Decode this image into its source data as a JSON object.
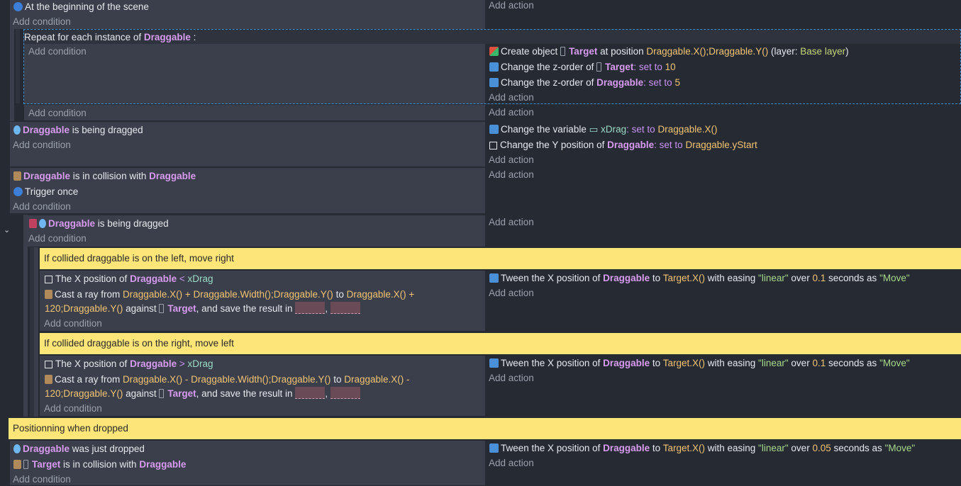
{
  "labels": {
    "add_condition": "Add condition",
    "add_action": "Add action"
  },
  "ev1": {
    "condition": "At the beginning of the scene"
  },
  "ev2": {
    "repeat_prefix": "Repeat for each instance of",
    "repeat_object": "Draggable",
    "repeat_colon": ":",
    "a1_pre": "Create object",
    "a1_obj": "Target",
    "a1_mid": "at position",
    "a1_expr": "Draggable.X();Draggable.Y()",
    "a1_layer_pre": "(layer:",
    "a1_layer": "Base layer",
    "a1_close": ")",
    "a2_pre": "Change the z-order of",
    "a2_obj": "Target",
    "a2_op": ": set to",
    "a2_val": "10",
    "a3_pre": "Change the z-order of",
    "a3_obj": "Draggable",
    "a3_op": ": set to",
    "a3_val": "5"
  },
  "ev3": {
    "c1_obj": "Draggable",
    "c1_rest": "is being dragged",
    "a1_pre": "Change the variable",
    "a1_var": "xDrag",
    "a1_op": ": set to",
    "a1_expr": "Draggable.X()",
    "a2_pre": "Change the Y position of",
    "a2_obj": "Draggable",
    "a2_op": ": set to",
    "a2_expr": "Draggable.yStart"
  },
  "ev4": {
    "c1_obj": "Draggable",
    "c1_mid": "is in collision with",
    "c1_obj2": "Draggable",
    "c2": "Trigger once"
  },
  "ev5": {
    "c1_obj": "Draggable",
    "c1_rest": "is being dragged"
  },
  "comment1": "If collided draggable is on the left, move right",
  "ev6": {
    "c1_pre": "The X position of",
    "c1_obj": "Draggable",
    "c1_op": "<",
    "c1_var": "xDrag",
    "c2_pre": "Cast a ray from",
    "c2_expr1": "Draggable.X() + Draggable.Width();Draggable.Y()",
    "c2_to": "to",
    "c2_expr2": "Draggable.X() +",
    "c2_line2_expr": "120;Draggable.Y()",
    "c2_against": "against",
    "c2_obj": "Target",
    "c2_rest": ", and save the result in",
    "a1_pre": "Tween the X position of",
    "a1_obj": "Draggable",
    "a1_to": "to",
    "a1_expr": "Target.X()",
    "a1_ease": "with easing",
    "a1_str": "\"linear\"",
    "a1_over": "over",
    "a1_val": "0.1",
    "a1_sec": "seconds as",
    "a1_name": "\"Move\""
  },
  "comment2": "If collided draggable is on the right, move left",
  "ev7": {
    "c1_pre": "The X position of",
    "c1_obj": "Draggable",
    "c1_op": ">",
    "c1_var": "xDrag",
    "c2_pre": "Cast a ray from",
    "c2_expr1": "Draggable.X() - Draggable.Width();Draggable.Y()",
    "c2_to": "to",
    "c2_expr2": "Draggable.X() -",
    "c2_line2_expr": "120;Draggable.Y()",
    "c2_against": "against",
    "c2_obj": "Target",
    "c2_rest": ", and save the result in",
    "a1_pre": "Tween the X position of",
    "a1_obj": "Draggable",
    "a1_to": "to",
    "a1_expr": "Target.X()",
    "a1_ease": "with easing",
    "a1_str": "\"linear\"",
    "a1_over": "over",
    "a1_val": "0.1",
    "a1_sec": "seconds as",
    "a1_name": "\"Move\""
  },
  "comment3": "Positionning when dropped",
  "ev8": {
    "c1_obj": "Draggable",
    "c1_rest": "was just dropped",
    "c2_obj": "Target",
    "c2_mid": "is in collision with",
    "c2_obj2": "Draggable",
    "a1_pre": "Tween the X position of",
    "a1_obj": "Draggable",
    "a1_to": "to",
    "a1_expr": "Target.X()",
    "a1_ease": "with easing",
    "a1_str": "\"linear\"",
    "a1_over": "over",
    "a1_val": "0.05",
    "a1_sec": "seconds as",
    "a1_name": "\"Move\""
  },
  "colors": {
    "comment": "#fde578",
    "object": "#d89bf0",
    "expression": "#f4c472",
    "condition_bg": "#3a3f4b",
    "action_bg": "#2b2f39"
  }
}
